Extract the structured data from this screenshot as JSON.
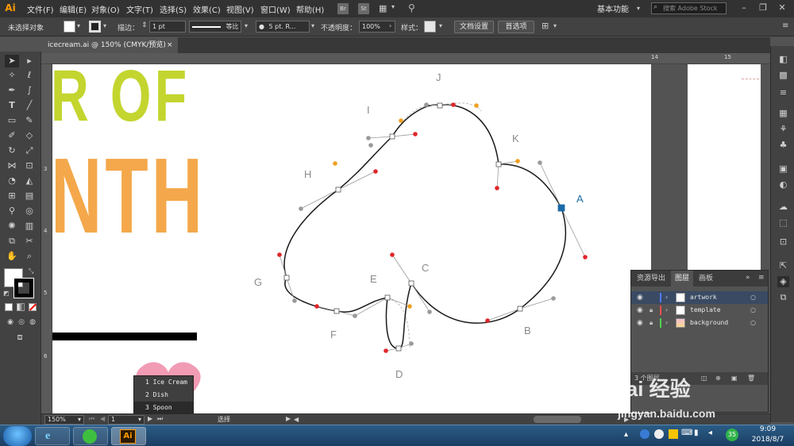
{
  "app": {
    "logo": "Ai",
    "menu": [
      "文件(F)",
      "编辑(E)",
      "对象(O)",
      "文字(T)",
      "选择(S)",
      "效果(C)",
      "视图(V)",
      "窗口(W)",
      "帮助(H)"
    ],
    "bridge_btn": "Br",
    "stock_btn": "St",
    "workspace": "基本功能",
    "stock_search_placeholder": "搜索 Adobe Stock",
    "window_controls": [
      "minimize-icon",
      "restore-icon",
      "close-icon"
    ]
  },
  "control_bar": {
    "selection_status": "未选择对象",
    "stroke_label": "描边：",
    "stroke_weight": "1 pt",
    "stroke_profile": "等比",
    "brush": "5 pt. R...",
    "opacity_label": "不透明度：",
    "opacity_value": "100%",
    "style_label": "样式：",
    "doc_setup_btn": "文档设置",
    "prefs_btn": "首选项"
  },
  "document_tab": {
    "title": "icecream.ai @ 150% (CMYK/预览)",
    "close": "×"
  },
  "rulers": {
    "top": [
      "14",
      "15"
    ],
    "left": [
      "3",
      "4",
      "5",
      "6"
    ]
  },
  "artwork": {
    "text_line1": "R OF",
    "text_line2": "NTH",
    "colors": {
      "green": "#c3d52e",
      "orange": "#f4a84b",
      "pink": "#f29bb4",
      "anchor_selected": "#1a6aa8",
      "handle_red": "#e0262a",
      "handle_orange": "#f0a020",
      "handle_gray": "#9a9a9a"
    },
    "anchor_labels": [
      "A",
      "B",
      "C",
      "D",
      "E",
      "F",
      "G",
      "H",
      "I",
      "J",
      "K"
    ]
  },
  "layers_panel": {
    "tabs": [
      "资源导出",
      "图层",
      "画板"
    ],
    "active_tab": "图层",
    "layers": [
      {
        "name": "artwork",
        "color": "#4f7cff",
        "locked": false
      },
      {
        "name": "template",
        "color": "#ff4f4f",
        "locked": true
      },
      {
        "name": "background",
        "color": "#4fd24f",
        "locked": true
      }
    ],
    "footer": "3 个图层"
  },
  "status_bar": {
    "zoom": "150%",
    "artboard_num": "1",
    "tool_status": "选择"
  },
  "popup_list": {
    "items": [
      "1 Ice Cream",
      "2 Dish",
      "3 Spoon"
    ]
  },
  "taskbar": {
    "time": "9:09",
    "date": "2018/8/7",
    "tray_badge": "35",
    "ai_button": "Ai"
  },
  "watermark": {
    "logo": "Bai 经验",
    "url": "jingyan.baidu.com"
  }
}
